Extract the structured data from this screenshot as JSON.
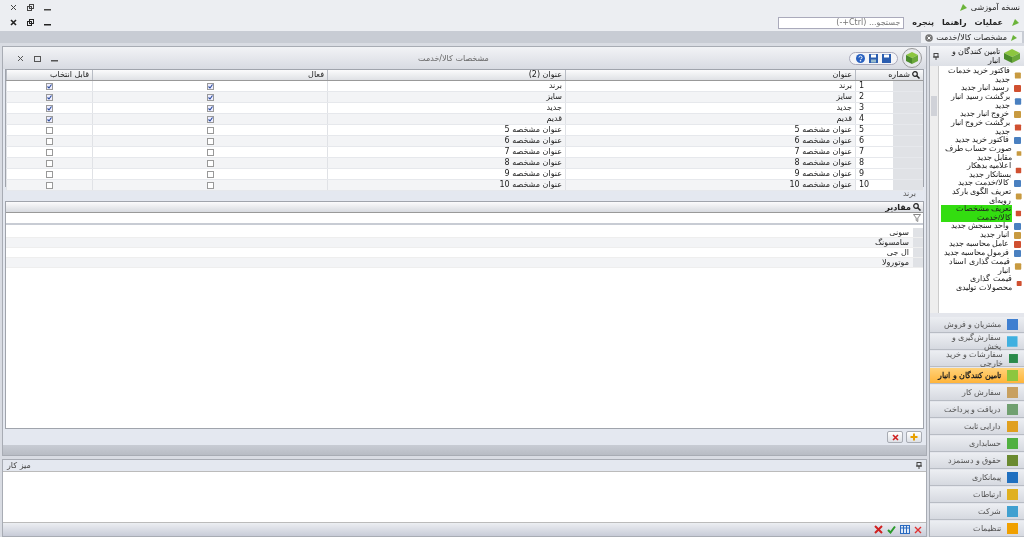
{
  "app": {
    "title": "نسخه آموزشی"
  },
  "menu": {
    "items": [
      "عملیات",
      "راهنما",
      "پنجره"
    ],
    "search": {
      "placeholder": "جستجو... (Ctrl+-)"
    }
  },
  "document_tabs": [
    {
      "label": "مشخصات کالا/خدمت",
      "selected": true
    }
  ],
  "form": {
    "title": "مشخصات کالا/خدمت",
    "table": {
      "columns": [
        "شماره",
        "عنوان",
        "عنوان (2)",
        "فعال",
        "قابل انتخاب"
      ],
      "rows": [
        {
          "number": "1",
          "title": "برند",
          "title_2": "برند",
          "active": true,
          "selectable": true
        },
        {
          "number": "2",
          "title": "سایز",
          "title_2": "سایز",
          "active": true,
          "selectable": true
        },
        {
          "number": "3",
          "title": "جدید",
          "title_2": "جدید",
          "active": true,
          "selectable": true
        },
        {
          "number": "4",
          "title": "قدیم",
          "title_2": "قدیم",
          "active": true,
          "selectable": true
        },
        {
          "number": "5",
          "title": "عنوان مشخصه 5",
          "title_2": "عنوان مشخصه 5",
          "active": false,
          "selectable": false
        },
        {
          "number": "6",
          "title": "عنوان مشخصه 6",
          "title_2": "عنوان مشخصه 6",
          "active": false,
          "selectable": false
        },
        {
          "number": "7",
          "title": "عنوان مشخصه 7",
          "title_2": "عنوان مشخصه 7",
          "active": false,
          "selectable": false
        },
        {
          "number": "8",
          "title": "عنوان مشخصه 8",
          "title_2": "عنوان مشخصه 8",
          "active": false,
          "selectable": false
        },
        {
          "number": "9",
          "title": "عنوان مشخصه 9",
          "title_2": "عنوان مشخصه 9",
          "active": false,
          "selectable": false
        },
        {
          "number": "10",
          "title": "عنوان مشخصه 10",
          "title_2": "عنوان مشخصه 10",
          "active": false,
          "selectable": false
        }
      ]
    },
    "detail": {
      "caption": "برند",
      "column": "مقادیر",
      "rows": [
        "سونی",
        "سامسونگ",
        "ال جی",
        "موتورولا"
      ]
    }
  },
  "workspace": {
    "title": "میز کار"
  },
  "nav": {
    "title": "تامین کنندگان و انبار",
    "items": [
      {
        "label": "فاکتور خرید خدمات جدید",
        "selected": false
      },
      {
        "label": "رسید انبار جدید",
        "selected": false
      },
      {
        "label": "برگشت رسید انبار جدید",
        "selected": false
      },
      {
        "label": "خروج انبار جدید",
        "selected": false
      },
      {
        "label": "برگشت خروج انبار جدید",
        "selected": false
      },
      {
        "label": "فاکتور خرید جدید",
        "selected": false
      },
      {
        "label": "صورت حساب طرف مقابل جدید",
        "selected": false
      },
      {
        "label": "اعلامیه بدهکار بستانکار جدید",
        "selected": false
      },
      {
        "label": "کالا/خدمت جدید",
        "selected": false
      },
      {
        "label": "تعریف الگوی بارکد رویه‌ای",
        "selected": false
      },
      {
        "label": "تعریف مشخصات کالا/خدمت",
        "selected": true
      },
      {
        "label": "واحد سنجش جدید",
        "selected": false
      },
      {
        "label": "انبار جدید",
        "selected": false
      },
      {
        "label": "عامل محاسبه جدید",
        "selected": false
      },
      {
        "label": "فرمول محاسبه جدید",
        "selected": false
      },
      {
        "label": "قیمت گذاری اسناد انبار",
        "selected": false
      },
      {
        "label": "قیمت گذاری محصولات تولیدی",
        "selected": false
      }
    ],
    "categories": [
      {
        "label": "مشتریان و فروش",
        "selected": false,
        "color": "#3f7fd0"
      },
      {
        "label": "سفارش‌گیری و پخش",
        "selected": false,
        "color": "#3fb0e0"
      },
      {
        "label": "سفارشات و خرید خارجی",
        "selected": false,
        "color": "#2a8a4a"
      },
      {
        "label": "تامین کنندگان و انبار",
        "selected": true,
        "color": "#8cc63f"
      },
      {
        "label": "سفارش کار",
        "selected": false,
        "color": "#c8a060"
      },
      {
        "label": "دریافت و پرداخت",
        "selected": false,
        "color": "#70a070"
      },
      {
        "label": "دارایی ثابت",
        "selected": false,
        "color": "#e0a020"
      },
      {
        "label": "حسابداری",
        "selected": false,
        "color": "#50b040"
      },
      {
        "label": "حقوق و دستمزد",
        "selected": false,
        "color": "#6a8a30"
      },
      {
        "label": "پیمانکاری",
        "selected": false,
        "color": "#2070c0"
      },
      {
        "label": "ارتباطات",
        "selected": false,
        "color": "#e0b020"
      },
      {
        "label": "شرکت",
        "selected": false,
        "color": "#40a0d0"
      },
      {
        "label": "تنظیمات",
        "selected": false,
        "color": "#f0a000"
      }
    ]
  }
}
